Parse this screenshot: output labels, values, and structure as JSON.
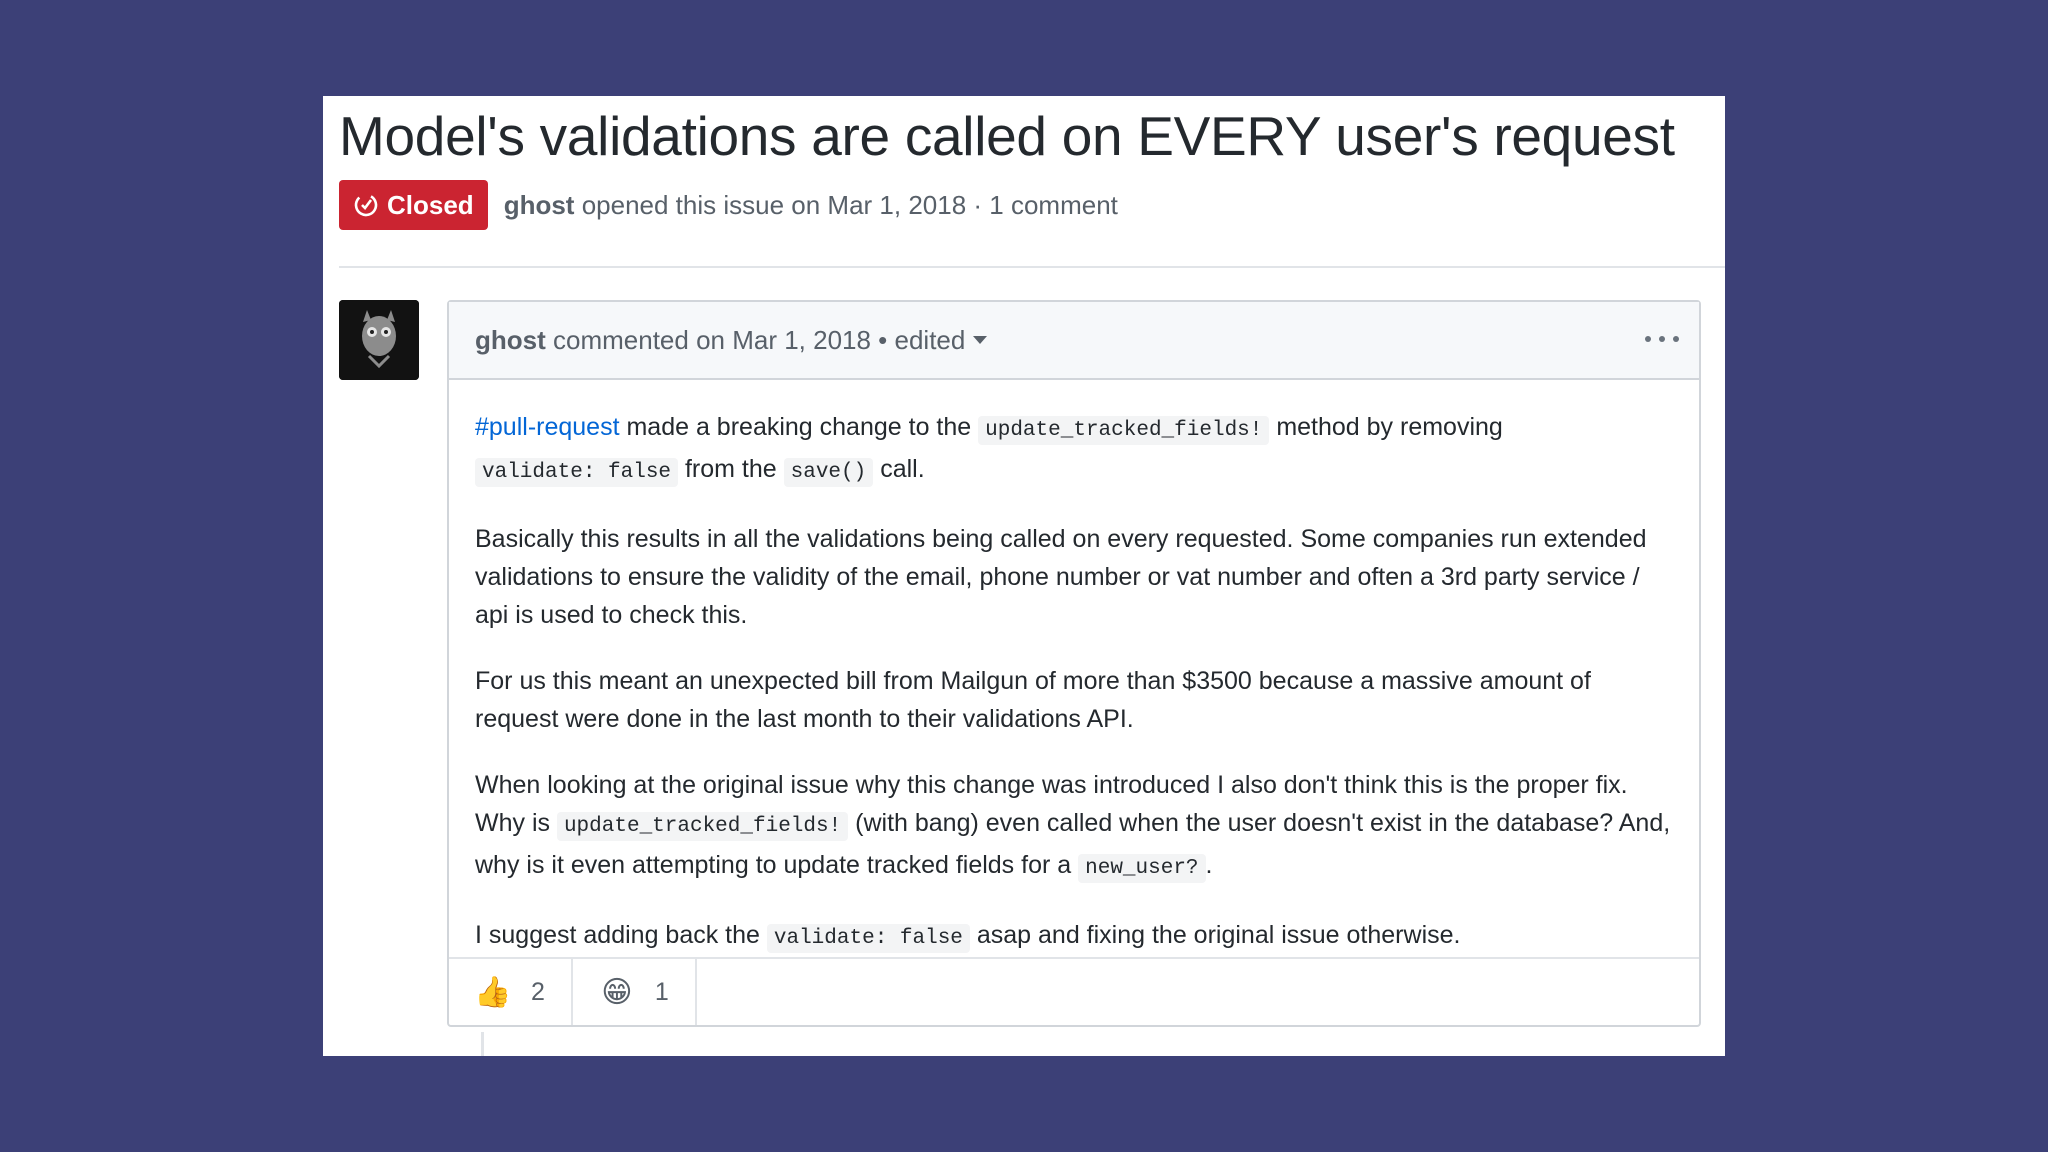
{
  "issue": {
    "title": "Model's validations are called on EVERY user's request",
    "state": "Closed",
    "state_color": "#cb2431",
    "author": "ghost",
    "meta": "opened this issue on Mar 1, 2018 · 1 comment"
  },
  "comment": {
    "author": "ghost",
    "meta": "commented on Mar 1, 2018 • edited",
    "menu_icon": "kebab-horizontal-icon",
    "body": {
      "p1": {
        "link": "#pull-request",
        "t1": " made a breaking change to the ",
        "c1": "update_tracked_fields!",
        "t2": " method by removing ",
        "c2": "validate: false",
        "t3": " from the ",
        "c3": "save()",
        "t4": " call."
      },
      "p2": "Basically this results in all the validations being called on every requested. Some companies run extended validations to ensure the validity of the email, phone number or vat number and often a 3rd party service / api is used to check this.",
      "p3": "For us this meant an unexpected bill from Mailgun of more than $3500 because a massive amount of request were done in the last month to their validations API.",
      "p4": {
        "t1": "When looking at the original issue why this change was introduced I also don't think this is the proper fix. Why is ",
        "c1": "update_tracked_fields!",
        "t2": " (with bang) even called when the user doesn't exist in the database? And, why is it even attempting to update tracked fields for a ",
        "c2": "new_user?",
        "t3": "."
      },
      "p5": {
        "t1": "I suggest adding back the ",
        "c1": "validate: false",
        "t2": " asap and fixing the original issue otherwise."
      }
    },
    "reactions": [
      {
        "emoji": "👍",
        "icon": "thumbs-up-icon",
        "count": "2"
      },
      {
        "emoji": "😁",
        "icon": "grinning-face-icon",
        "count": "1"
      }
    ]
  },
  "colors": {
    "background": "#3c4077",
    "link": "#0366d6",
    "closed": "#cb2431"
  }
}
